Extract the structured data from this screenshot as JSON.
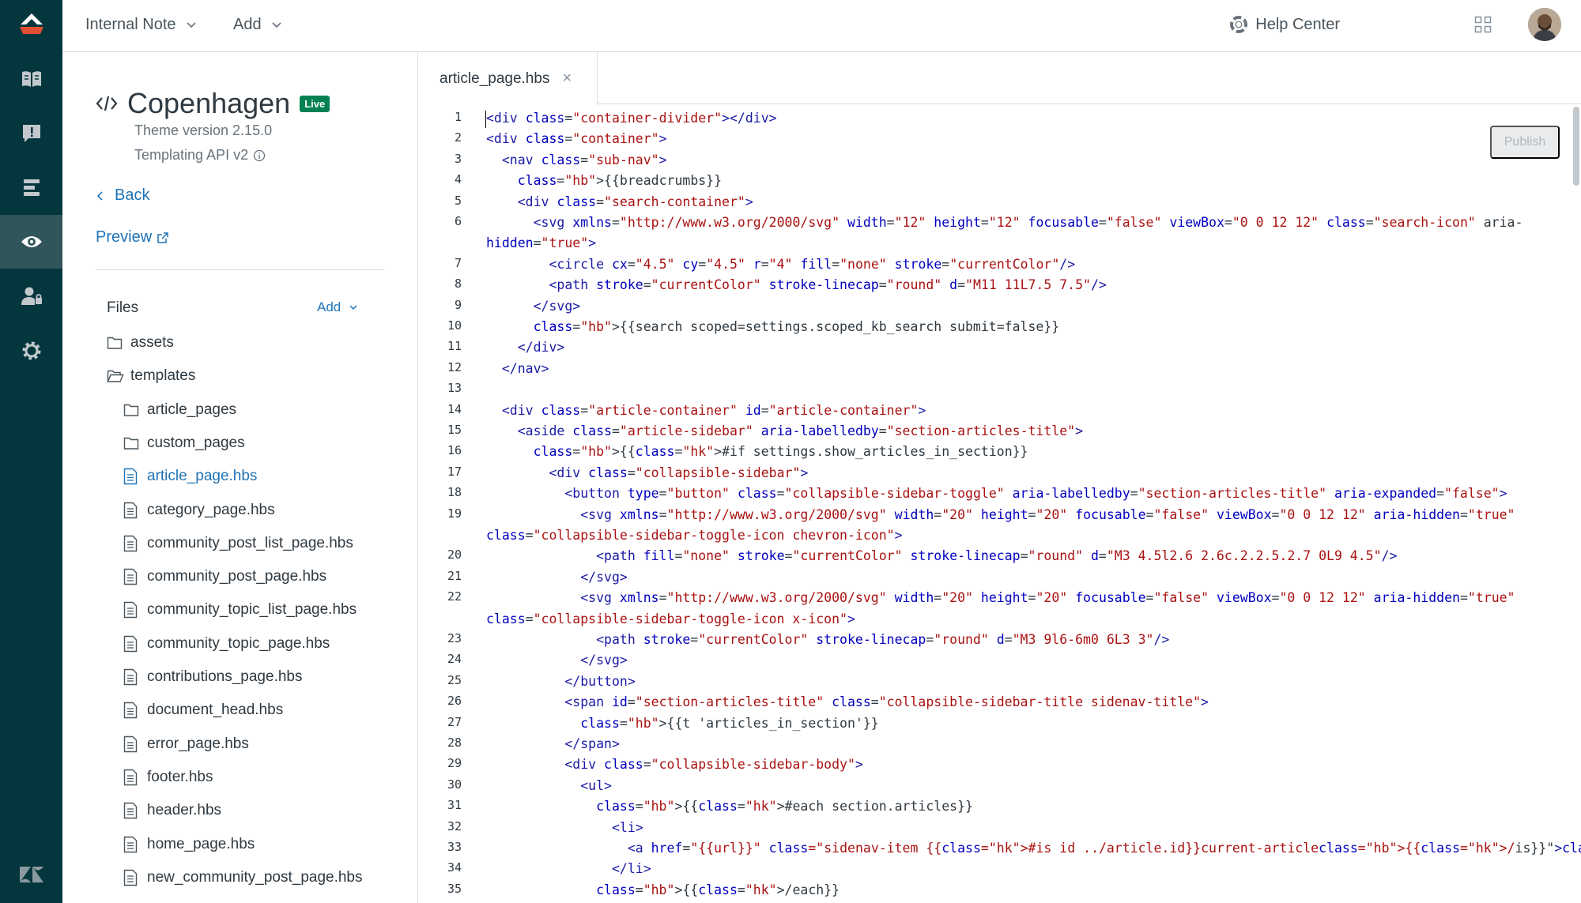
{
  "topbar": {
    "internal_note": "Internal Note",
    "add": "Add",
    "help_center": "Help Center"
  },
  "sidebar": {
    "theme_name": "Copenhagen",
    "live_badge": "Live",
    "theme_version": "Theme version 2.15.0",
    "templating_api": "Templating API v2",
    "back": "Back",
    "preview": "Preview",
    "files_label": "Files",
    "files_add": "Add",
    "files": [
      {
        "name": "assets",
        "type": "folder",
        "level": 0
      },
      {
        "name": "templates",
        "type": "folder-open",
        "level": 0
      },
      {
        "name": "article_pages",
        "type": "folder",
        "level": 1
      },
      {
        "name": "custom_pages",
        "type": "folder",
        "level": 1
      },
      {
        "name": "article_page.hbs",
        "type": "file",
        "level": 1,
        "selected": true
      },
      {
        "name": "category_page.hbs",
        "type": "file",
        "level": 1
      },
      {
        "name": "community_post_list_page.hbs",
        "type": "file",
        "level": 1
      },
      {
        "name": "community_post_page.hbs",
        "type": "file",
        "level": 1
      },
      {
        "name": "community_topic_list_page.hbs",
        "type": "file",
        "level": 1
      },
      {
        "name": "community_topic_page.hbs",
        "type": "file",
        "level": 1
      },
      {
        "name": "contributions_page.hbs",
        "type": "file",
        "level": 1
      },
      {
        "name": "document_head.hbs",
        "type": "file",
        "level": 1
      },
      {
        "name": "error_page.hbs",
        "type": "file",
        "level": 1
      },
      {
        "name": "footer.hbs",
        "type": "file",
        "level": 1
      },
      {
        "name": "header.hbs",
        "type": "file",
        "level": 1
      },
      {
        "name": "home_page.hbs",
        "type": "file",
        "level": 1
      },
      {
        "name": "new_community_post_page.hbs",
        "type": "file",
        "level": 1
      }
    ]
  },
  "editor": {
    "tab_name": "article_page.hbs",
    "tab_close": "×",
    "publish": "Publish",
    "line_numbers": [
      "1",
      "2",
      "3",
      "4",
      "5",
      "6",
      "7",
      "8",
      "9",
      "10",
      "11",
      "12",
      "13",
      "14",
      "15",
      "16",
      "17",
      "18",
      "19",
      "20",
      "21",
      "22",
      "23",
      "24",
      "25",
      "26",
      "27",
      "28",
      "29",
      "30",
      "31",
      "32",
      "33",
      "34",
      "35"
    ],
    "code_lines": [
      "<div class=\"container-divider\"></div>",
      "<div class=\"container\">",
      "  <nav class=\"sub-nav\">",
      "    {{breadcrumbs}}",
      "    <div class=\"search-container\">",
      "      <svg xmlns=\"http://www.w3.org/2000/svg\" width=\"12\" height=\"12\" focusable=\"false\" viewBox=\"0 0 12 12\" class=\"search-icon\" aria-",
      "hidden=\"true\">",
      "        <circle cx=\"4.5\" cy=\"4.5\" r=\"4\" fill=\"none\" stroke=\"currentColor\"/>",
      "        <path stroke=\"currentColor\" stroke-linecap=\"round\" d=\"M11 11L7.5 7.5\"/>",
      "      </svg>",
      "      {{search scoped=settings.scoped_kb_search submit=false}}",
      "    </div>",
      "  </nav>",
      "",
      "  <div class=\"article-container\" id=\"article-container\">",
      "    <aside class=\"article-sidebar\" aria-labelledby=\"section-articles-title\">",
      "      {{#if settings.show_articles_in_section}}",
      "        <div class=\"collapsible-sidebar\">",
      "          <button type=\"button\" class=\"collapsible-sidebar-toggle\" aria-labelledby=\"section-articles-title\" aria-expanded=\"false\">",
      "            <svg xmlns=\"http://www.w3.org/2000/svg\" width=\"20\" height=\"20\" focusable=\"false\" viewBox=\"0 0 12 12\" aria-hidden=\"true\"",
      "class=\"collapsible-sidebar-toggle-icon chevron-icon\">",
      "              <path fill=\"none\" stroke=\"currentColor\" stroke-linecap=\"round\" d=\"M3 4.5l2.6 2.6c.2.2.5.2.7 0L9 4.5\"/>",
      "            </svg>",
      "            <svg xmlns=\"http://www.w3.org/2000/svg\" width=\"20\" height=\"20\" focusable=\"false\" viewBox=\"0 0 12 12\" aria-hidden=\"true\"",
      "class=\"collapsible-sidebar-toggle-icon x-icon\">",
      "              <path stroke=\"currentColor\" stroke-linecap=\"round\" d=\"M3 9l6-6m0 6L3 3\"/>",
      "            </svg>",
      "          </button>",
      "          <span id=\"section-articles-title\" class=\"collapsible-sidebar-title sidenav-title\">",
      "            {{t 'articles_in_section'}}",
      "          </span>",
      "          <div class=\"collapsible-sidebar-body\">",
      "            <ul>",
      "              {{#each section.articles}}",
      "                <li>",
      "                  <a href=\"{{url}}\" class=\"sidenav-item {{#is id ../article.id}}current-article{{/is}}\">{{title}}</a>",
      "                </li>",
      "              {{/each}}"
    ],
    "line_number_rows": [
      0,
      1,
      2,
      3,
      4,
      5,
      7,
      8,
      9,
      10,
      11,
      12,
      13,
      14,
      15,
      16,
      17,
      18,
      19,
      21,
      22,
      23,
      25,
      26,
      27,
      28,
      29,
      30,
      31,
      32,
      33,
      34,
      35,
      36,
      37
    ]
  }
}
